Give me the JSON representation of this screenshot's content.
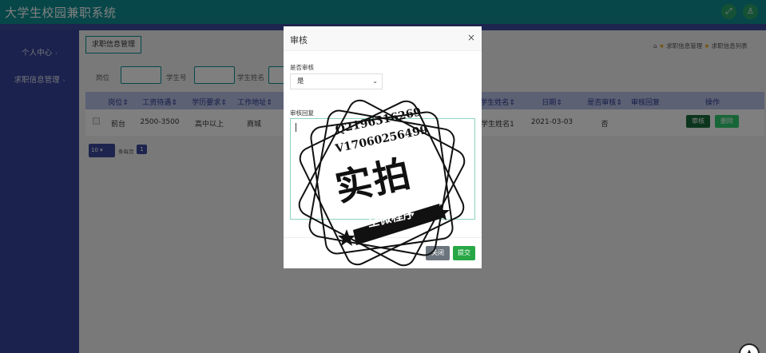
{
  "app": {
    "title": "大学生校园兼职系统"
  },
  "topbar": {
    "expand_icon": "expand-icon",
    "user_icon": "user-icon"
  },
  "sidebar": {
    "items": [
      {
        "label": "个人中心"
      },
      {
        "label": "求职信息管理"
      }
    ]
  },
  "breadcrumb": {
    "button": "求职信息管理",
    "trail": [
      "求职信息管理",
      "求职信息列表"
    ]
  },
  "search": {
    "labels": [
      "岗位",
      "学生号",
      "学生姓名"
    ]
  },
  "table": {
    "headers": [
      "岗位",
      "工资待遇",
      "学历要求",
      "工作地址",
      "学生姓名",
      "日期",
      "是否审核",
      "审核回复",
      "操作"
    ],
    "rows": [
      {
        "post": "前台",
        "salary": "2500-3500",
        "education": "高中以上",
        "address": "商城",
        "student_name": "学生姓名1",
        "date": "2021-03-03",
        "audited": "否",
        "reply": ""
      }
    ],
    "actions": {
      "audit": "审核",
      "delete": "删除"
    }
  },
  "pagination": {
    "page_size": "10",
    "page_size_label": "条每页",
    "current_page": "1"
  },
  "modal": {
    "title": "审核",
    "close_glyph": "×",
    "audit_label": "是否审核",
    "audit_value": "是",
    "reply_label": "审核回复",
    "close_button": "关闭",
    "submit_button": "提交"
  },
  "watermark": {
    "phone1": "Q2196316269",
    "phone2": "V17060256499",
    "big": "实拍",
    "ribbon": "全微程序"
  },
  "colors": {
    "topbar": "#0e8f93",
    "sidebar": "#34449a",
    "table_header": "#b8c3e8",
    "audit_button": "#186a3b",
    "delete_button": "#2ecc71",
    "submit_button": "#28a745"
  }
}
